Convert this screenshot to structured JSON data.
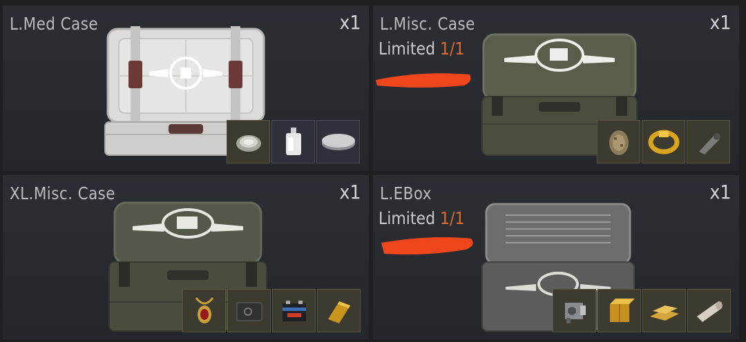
{
  "cards": [
    {
      "name": "L.Med Case",
      "quantity": "x1",
      "limited": null,
      "case_color": "#d9d8d6",
      "loot": [
        "silver-plate-icon",
        "perfume-bottle-icon",
        "silver-disc-icon"
      ]
    },
    {
      "name": "L.Misc. Case",
      "quantity": "x1",
      "limited": {
        "label": "Limited",
        "count": "1/1"
      },
      "case_color": "#545745",
      "loot": [
        "egg-ornament-icon",
        "gold-ring-icon",
        "whistle-icon"
      ]
    },
    {
      "name": "XL.Misc. Case",
      "quantity": "x1",
      "limited": null,
      "case_color": "#525644",
      "loot": [
        "ruby-necklace-icon",
        "small-safe-icon",
        "car-battery-icon",
        "gold-bar-icon"
      ]
    },
    {
      "name": "L.EBox",
      "quantity": "x1",
      "limited": {
        "label": "Limited",
        "count": "1/1"
      },
      "case_color": "#6a6b6b",
      "loot": [
        "engine-part-icon",
        "gold-cube-icon",
        "gold-bars-icon",
        "paper-roll-icon"
      ]
    }
  ],
  "colors": {
    "background": "#1e2124",
    "card": "#2a2e32",
    "limited_count": "#e06a2e",
    "redaction": "#f0461c",
    "slot_bg": "#3d3a2f"
  }
}
